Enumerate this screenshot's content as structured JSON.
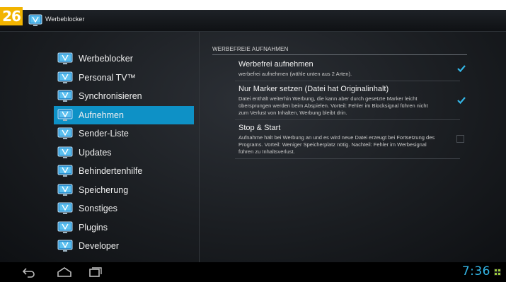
{
  "step_badge": "26",
  "app": {
    "title": "Werbeblocker",
    "icon": "tv-app-icon"
  },
  "sidebar": {
    "items": [
      {
        "label": "Werbeblocker",
        "icon": "tv-icon",
        "active": false
      },
      {
        "label": "Personal TV™",
        "icon": "tv-icon",
        "active": false
      },
      {
        "label": "Synchronisieren",
        "icon": "tv-icon",
        "active": false
      },
      {
        "label": "Aufnehmen",
        "icon": "tv-icon",
        "active": true
      },
      {
        "label": "Sender-Liste",
        "icon": "tv-icon",
        "active": false
      },
      {
        "label": "Updates",
        "icon": "tv-icon",
        "active": false
      },
      {
        "label": "Behindertenhilfe",
        "icon": "tv-icon",
        "active": false
      },
      {
        "label": "Speicherung",
        "icon": "tv-icon",
        "active": false
      },
      {
        "label": "Sonstiges",
        "icon": "tv-icon",
        "active": false
      },
      {
        "label": "Plugins",
        "icon": "tv-icon",
        "active": false
      },
      {
        "label": "Developer",
        "icon": "tv-icon",
        "active": false
      }
    ]
  },
  "preferences": {
    "category": "WERBEFREIE AUFNAHMEN",
    "items": [
      {
        "title": "Werbefrei aufnehmen",
        "summary": "werbefrei aufnehmen (wähle unten aus 2 Arten).",
        "checked": true
      },
      {
        "title": "Nur Marker setzen (Datei hat Originalinhalt)",
        "summary": "Datei enthält weiterhin Werbung, die kann aber durch gesetzte Marker leicht übersprungen werden beim Abspielen. Vorteil: Fehler im Blocksignal führen nicht zum Verlust von Inhalten, Werbung bleibt drin.",
        "checked": true
      },
      {
        "title": "Stop & Start",
        "summary": "Aufnahme hält bei Werbung an und es wird neue Datei erzeugt bei Fortsetzung des Programs. Vorteil: Weniger Speicherplatz nötig. Nachteil: Fehler im Werbesignal führen zu Inhaltsverlust.",
        "checked": false
      }
    ]
  },
  "navbar": {
    "back_icon": "back-icon",
    "home_icon": "home-icon",
    "recents_icon": "recent-apps-icon",
    "clock": "7:36",
    "notification_icon": "notification-icon"
  },
  "colors": {
    "accent": "#33b5e5",
    "selected": "#0e91c6",
    "badge": "#f2b400"
  }
}
